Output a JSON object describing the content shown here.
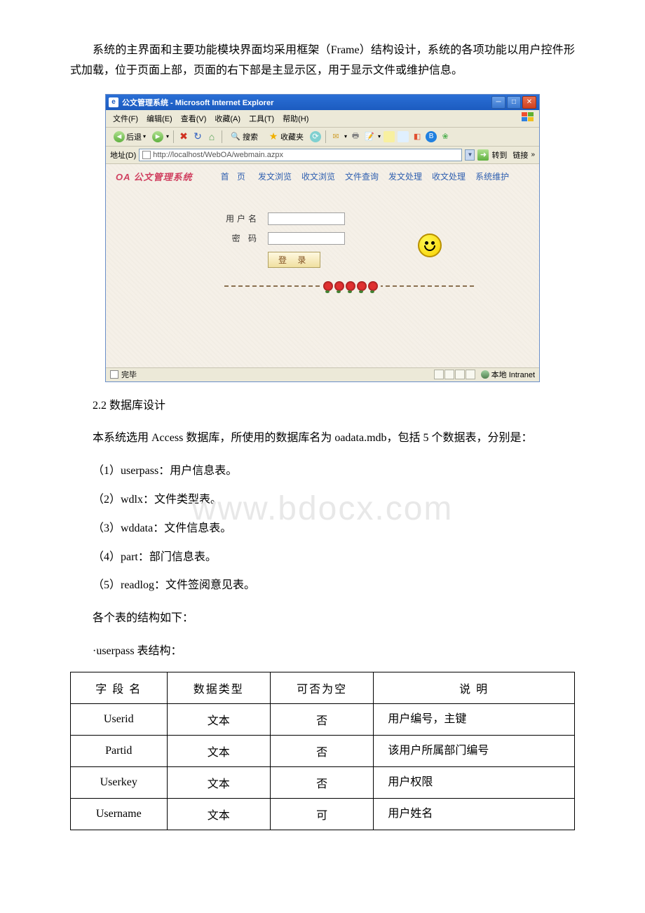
{
  "para_intro": "系统的主界面和主要功能模块界面均采用框架（Frame）结构设计，系统的各项功能以用户控件形式加载，位于页面上部，页面的右下部是主显示区，用于显示文件或维护信息。",
  "watermark": "www.bdocx.com",
  "browser": {
    "title": "公文管理系统 - Microsoft Internet Explorer",
    "menus": [
      "文件(F)",
      "编辑(E)",
      "查看(V)",
      "收藏(A)",
      "工具(T)",
      "帮助(H)"
    ],
    "toolbar": {
      "back": "后退",
      "search": "搜索",
      "favorites": "收藏夹"
    },
    "addr_label": "地址(D)",
    "url": "http://localhost/WebOA/webmain.azpx",
    "go_label": "转到",
    "link_label": "链接",
    "oa_logo": "OA  公文管理系统",
    "nav": [
      "首  页",
      "发文浏览",
      "收文浏览",
      "文件查询",
      "发文处理",
      "收文处理",
      "系统维护"
    ],
    "form": {
      "user_label": "用户名",
      "pass_label": "密  码",
      "login": "登  录"
    },
    "status_done": "完毕",
    "status_zone": "本地 Intranet"
  },
  "section_22": "2.2 数据库设计",
  "para_db": "本系统选用 Access 数据库，所使用的数据库名为 oadata.mdb，包括 5 个数据表，分别是：",
  "db_list": [
    "（1）userpass：用户信息表。",
    "（2）wdlx：文件类型表。",
    "（3）wddata：文件信息表。",
    "（4）part：部门信息表。",
    "（5）readlog：文件签阅意见表。"
  ],
  "para_tables": "各个表的结构如下：",
  "table_caption": "·userpass 表结构：",
  "table": {
    "headers": [
      "字 段 名",
      "数据类型",
      "可否为空",
      "说  明"
    ],
    "rows": [
      {
        "f": "Userid",
        "t": "文本",
        "n": "否",
        "d": "用户编号，主键"
      },
      {
        "f": "Partid",
        "t": "文本",
        "n": "否",
        "d": "该用户所属部门编号"
      },
      {
        "f": "Userkey",
        "t": "文本",
        "n": "否",
        "d": "用户权限"
      },
      {
        "f": "Username",
        "t": "文本",
        "n": "可",
        "d": "用户姓名"
      }
    ]
  }
}
